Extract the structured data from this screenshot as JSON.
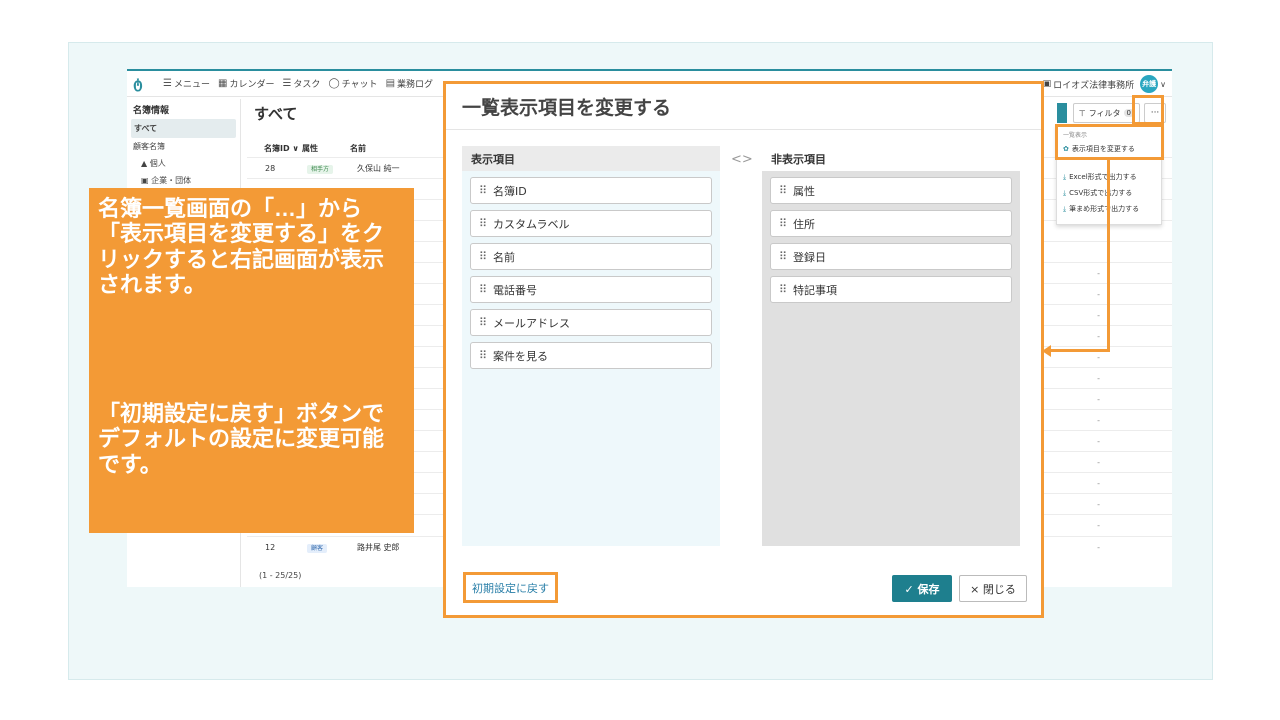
{
  "topbar": {
    "menu": "メニュー",
    "calendar": "カレンダー",
    "task": "タスク",
    "chat": "チャット",
    "work_log": "業務ログ",
    "office": "ロイオズ法律事務所",
    "avatar": "弁護"
  },
  "sidebar": {
    "title": "名簿情報",
    "all": "すべて",
    "client_list": "顧客名簿",
    "individual": "個人",
    "company": "企業・団体"
  },
  "main": {
    "title": "すべて",
    "col_id": "名簿ID ∨",
    "col_attr": "属性",
    "col_name": "名前",
    "rows": [
      {
        "id": "28",
        "attr": "相手方",
        "name": "久保山 純一"
      },
      {
        "id": "12",
        "attr": "顧客",
        "name": "路井尾 史郎"
      }
    ],
    "count": "(1 - 25/25)",
    "dash": "-"
  },
  "toolbar": {
    "filter": "フィルタ",
    "filter_count": "0",
    "more": "···"
  },
  "dropdown": {
    "section": "一覧表示",
    "change_columns": "表示項目を変更する",
    "excel": "Excel形式で出力する",
    "csv": "CSV形式で出力する",
    "summary": "筆まめ形式で出力する"
  },
  "callout": {
    "text1": "名簿一覧画面の「…」から「表示項目を変更する」をクリックすると右記画面が表示されます。",
    "text2": "「初期設定に戻す」ボタンでデフォルトの設定に変更可能です。"
  },
  "modal": {
    "title": "一覧表示項目を変更する",
    "visible_title": "表示項目",
    "hidden_title": "非表示項目",
    "visible_items": [
      "名簿ID",
      "カスタムラベル",
      "名前",
      "電話番号",
      "メールアドレス",
      "案件を見る"
    ],
    "hidden_items": [
      "属性",
      "住所",
      "登録日",
      "特記事項"
    ],
    "reset": "初期設定に戻す",
    "save": "✓ 保存",
    "close": "× 閉じる"
  },
  "colors": {
    "accent_orange": "#f39a36",
    "brand_teal": "#1e7f8e"
  }
}
